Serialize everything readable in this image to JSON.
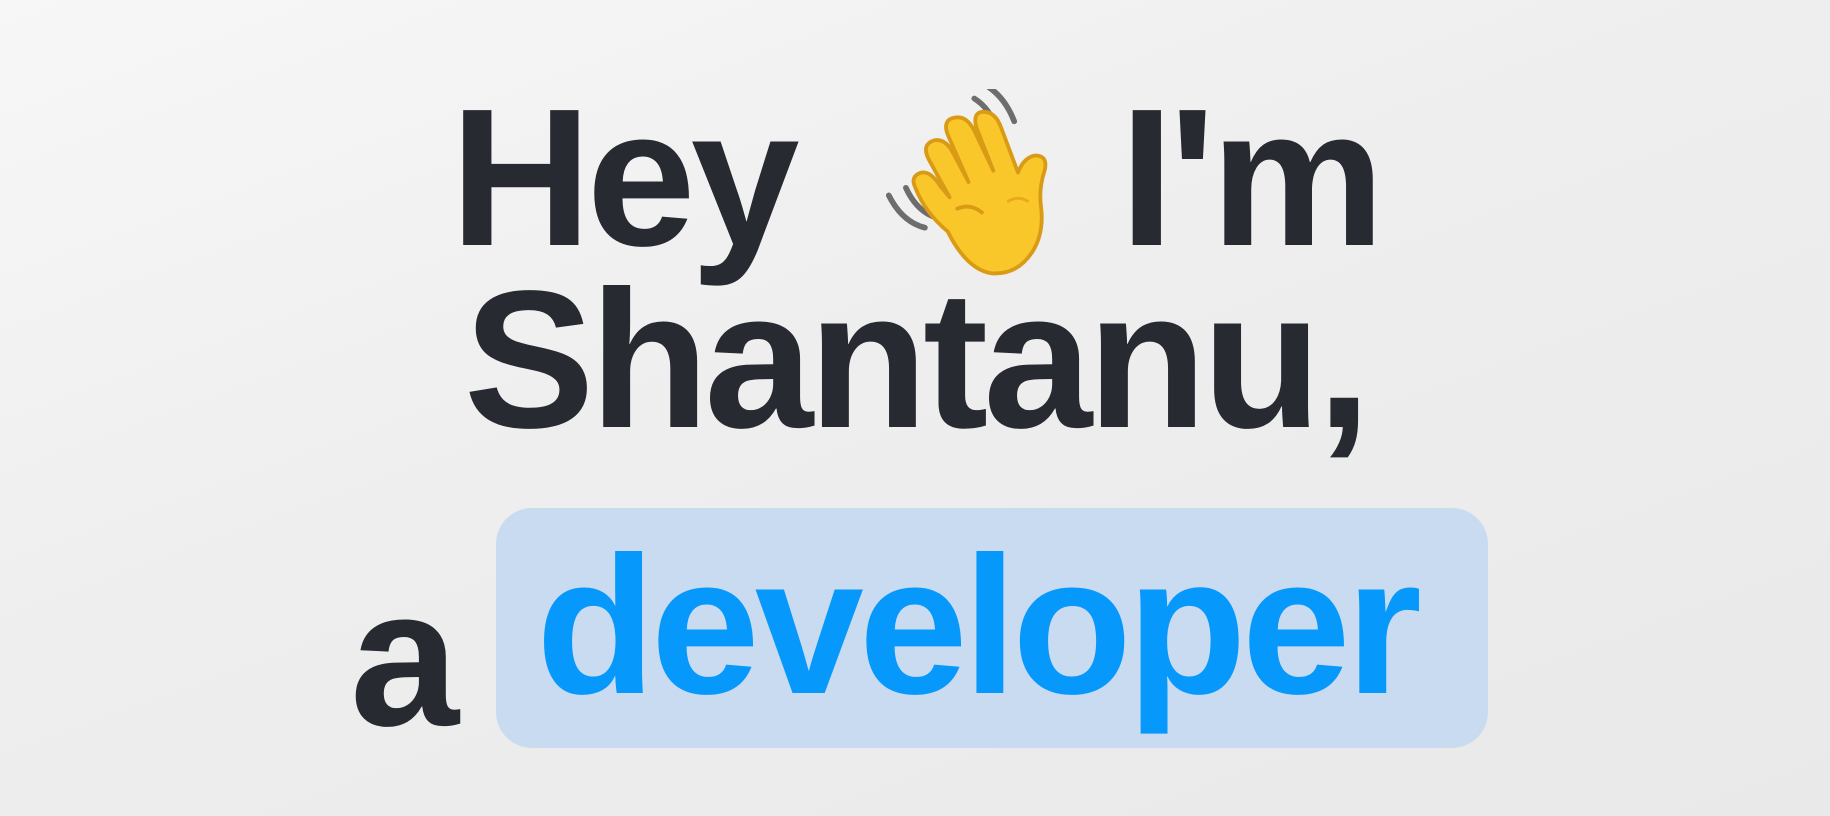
{
  "hero": {
    "line1_part1": "Hey",
    "wave_emoji": "waving-hand-emoji",
    "line1_part2": "I'm",
    "line2": "Shantanu,",
    "article": "a",
    "role": "developer"
  },
  "colors": {
    "text": "#272a31",
    "accent": "#0798fb",
    "highlight_bg": "#c8dbf0",
    "background": "#eeeeee",
    "wave_hand": "#f9c72a"
  }
}
